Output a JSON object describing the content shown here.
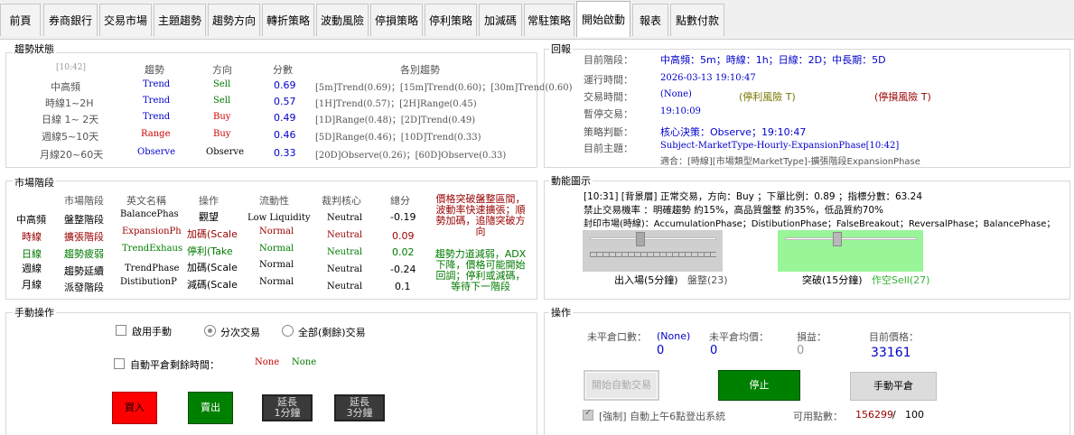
{
  "tabs": [
    "前頁",
    "券商銀行",
    "交易市場",
    "主題趨勢",
    "趨勢方向",
    "轉折策略",
    "波動風險",
    "停損策略",
    "停利策略",
    "加減碼",
    "常駐策略",
    "開始啟動",
    "報表",
    "點數付款"
  ],
  "trend": {
    "section_title": "趨勢狀態",
    "time": "[10:42]",
    "headers": [
      "趨勢",
      "方向",
      "分數",
      "各別趨勢"
    ],
    "rows": [
      {
        "label": "中高頻",
        "trend": "Trend",
        "dir": "Sell",
        "score": "0.69",
        "detail": "[5m]Trend(0.69)；[15m]Trend(0.60)；[30m]Trend(0.60)"
      },
      {
        "label": "時線1~2H",
        "trend": "Trend",
        "dir": "Sell",
        "score": "0.57",
        "detail": "[1H]Trend(0.57)；[2H]Range(0.45)"
      },
      {
        "label": "日線 1~ 2天",
        "trend": "Trend",
        "dir": "Buy",
        "score": "0.49",
        "detail": "[1D]Range(0.48)；[2D]Trend(0.49)"
      },
      {
        "label": "週線5~10天",
        "trend": "Range",
        "dir": "Buy",
        "score": "0.46",
        "detail": "[5D]Range(0.46)；[10D]Trend(0.33)"
      },
      {
        "label": "月線20~60天",
        "trend": "Observe",
        "dir": "Observe",
        "score": "0.33",
        "detail": "[20D]Observe(0.26)；[60D]Observe(0.33)"
      }
    ]
  },
  "market": {
    "section_title": "市場階段",
    "headers": [
      "市場階段",
      "英文名稱",
      "操作",
      "流動性",
      "裁判核心",
      "總分"
    ],
    "rows": [
      {
        "label": "中高頻",
        "phase": "盤整階段",
        "en": "BalancePhas",
        "op": "觀望",
        "liq": "Low Liquidity",
        "core": "Neutral",
        "score": "-0.19"
      },
      {
        "label": "時線",
        "phase": "擴張階段",
        "en": "ExpansionPh",
        "op": "加碼(Scale",
        "liq": "Normal",
        "core": "Neutral",
        "score": "0.09"
      },
      {
        "label": "日線",
        "phase": "趨勢疲弱",
        "en": "TrendExhaus",
        "op": "停利(Take",
        "liq": "Normal",
        "core": "Neutral",
        "score": "0.02"
      },
      {
        "label": "週線",
        "phase": "趨勢延續",
        "en": "TrendPhase",
        "op": "加碼(Scale",
        "liq": "Normal",
        "core": "Neutral",
        "score": "-0.24"
      },
      {
        "label": "月線",
        "phase": "派發階段",
        "en": "DistibutionP",
        "op": "減碼(Scale",
        "liq": "Normal",
        "core": "Neutral",
        "score": "0.1"
      }
    ],
    "note1": "價格突破盤整區間，波動率快速擴張；順勢加碼，追隨突破方向",
    "note2": "趨勢力道減弱，ADX下降，價格可能開始回調；停利或減碼，等待下一階段"
  },
  "report": {
    "section_title": "回報",
    "labels": [
      "目前階段：",
      "運行時間：",
      "交易時間：",
      "暫停交易：",
      "策略判斷：",
      "目前主題："
    ],
    "stage": "中高頻：5m；時線：1h；日線：2D；中長期：5D",
    "run_time": "2026-03-13 19:10:47",
    "trade_none": "(None)",
    "take_profit": "(停利風險 T)",
    "stop_loss": "(停損風險 T)",
    "pause_time": "19:10:09",
    "strategy": "核心決策：Observe；19:10:47",
    "theme": "Subject-MarketType-Hourly-ExpansionPhase[10:42]",
    "theme_sub": "適合：[時線][市場類型MarketType]-擴張階段ExpansionPhase"
  },
  "momentum": {
    "section_title": "動能圖示",
    "line1": "[10:31] [背景層] 正常交易，方向：Buy ；下單比例：0.89 ；指標分數：63.24",
    "line2": "禁止交易機率 ：明確趨勢 約15%，高品質盤整 約35%，低品質約70%",
    "line3": "封印市場(時線)：AccumulationPhase；DistibutionPhase；FalseBreakout；ReversalPhase；BalancePhase；",
    "slider1_label": "出入場(5分鐘)",
    "slider1_sub": "盤整(23)",
    "slider1_level": 0.4,
    "slider2_label": "突破(15分鐘)",
    "slider2_sub": "作空Sell(27)",
    "slider2_level": 0.4
  },
  "manual": {
    "section_title": "手動操作",
    "enable_manual": "啟用手動",
    "split_trade": "分次交易",
    "all_trade": "全部(剩餘)交易",
    "auto_close": "自動平倉剩餘時間：",
    "none1": "None",
    "none2": "None",
    "buy": "買入",
    "sell": "賣出",
    "extend1": "延長\n1分鐘",
    "extend3": "延長\n3分鐘"
  },
  "operate": {
    "section_title": "操作",
    "open_lots_label": "未平倉口數：",
    "open_lots_none": "(None)",
    "open_lots_val": "0",
    "avg_label": "未平倉均價：",
    "avg_val": "0",
    "pnl_label": "損益：",
    "pnl_val": "0",
    "price_label": "目前價格：",
    "price_val": "33161",
    "start_auto": "開始自動交易",
    "stop": "停止",
    "manual_close": "手動平倉",
    "force_logout": "[強制] 自動上午6點登出系統",
    "points_label": "可用點數：",
    "points_val": "156299",
    "points_sep": "/",
    "points_max": "100"
  }
}
